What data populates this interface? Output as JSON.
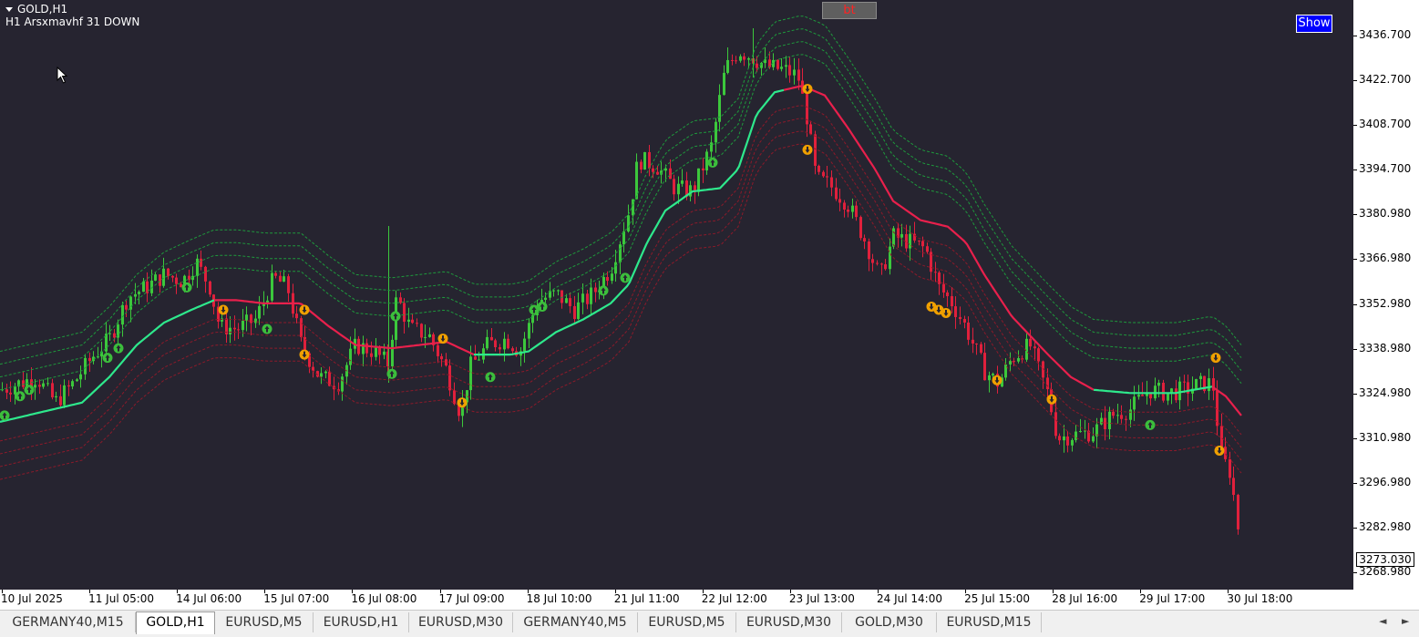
{
  "chart": {
    "symbol_line": "GOLD,H1",
    "indicator_line": "H1 Arsxmavhf 31 DOWN",
    "bt_label": "bt",
    "show_label": "Show",
    "current_price": "3273.030"
  },
  "colors": {
    "background": "#262430",
    "bull_candle": "#3cc83c",
    "bear_candle": "#e0203c",
    "ma_up": "#2ee88c",
    "ma_down": "#e8204c",
    "band_up": "#1e9a3c",
    "band_down": "#8c1a2a",
    "buy_marker": "#3cbe3c",
    "sell_marker": "#f0a000"
  },
  "price_axis": [
    "3436.700",
    "3422.700",
    "3408.700",
    "3394.700",
    "3380.980",
    "3366.980",
    "3352.980",
    "3338.980",
    "3324.980",
    "3310.980",
    "3296.980",
    "3282.980",
    "3268.980"
  ],
  "time_axis": [
    "10 Jul 2025",
    "11 Jul 05:00",
    "14 Jul 06:00",
    "15 Jul 07:00",
    "16 Jul 08:00",
    "17 Jul 09:00",
    "18 Jul 10:00",
    "21 Jul 11:00",
    "22 Jul 12:00",
    "23 Jul 13:00",
    "24 Jul 14:00",
    "25 Jul 15:00",
    "28 Jul 16:00",
    "29 Jul 17:00",
    "30 Jul 18:00"
  ],
  "tabs": [
    {
      "label": "GERMANY40,M15",
      "active": false
    },
    {
      "label": "GOLD,H1",
      "active": true
    },
    {
      "label": "EURUSD,M5",
      "active": false
    },
    {
      "label": "EURUSD,H1",
      "active": false
    },
    {
      "label": "EURUSD,M30",
      "active": false
    },
    {
      "label": "GERMANY40,M5",
      "active": false
    },
    {
      "label": "EURUSD,M5",
      "active": false
    },
    {
      "label": "EURUSD,M30",
      "active": false
    },
    {
      "label": "GOLD,M30",
      "active": false
    },
    {
      "label": "EURUSD,M15",
      "active": false
    }
  ],
  "scroll": {
    "left_icon": "◄",
    "right_icon": "►"
  },
  "chart_data": {
    "type": "candlestick",
    "ma_line": [
      [
        0,
        3316
      ],
      [
        30,
        3318
      ],
      [
        60,
        3320
      ],
      [
        90,
        3322
      ],
      [
        120,
        3330
      ],
      [
        150,
        3340
      ],
      [
        180,
        3347
      ],
      [
        210,
        3351
      ],
      [
        235,
        3354
      ],
      [
        260,
        3354
      ],
      [
        290,
        3353
      ],
      [
        330,
        3353
      ],
      [
        360,
        3346
      ],
      [
        390,
        3340
      ],
      [
        430,
        3339
      ],
      [
        460,
        3340
      ],
      [
        490,
        3341
      ],
      [
        520,
        3337
      ],
      [
        560,
        3337
      ],
      [
        580,
        3338
      ],
      [
        610,
        3344
      ],
      [
        640,
        3348
      ],
      [
        670,
        3353
      ],
      [
        690,
        3359
      ],
      [
        710,
        3372
      ],
      [
        730,
        3382
      ],
      [
        760,
        3388
      ],
      [
        790,
        3389
      ],
      [
        810,
        3395
      ],
      [
        830,
        3412
      ],
      [
        850,
        3419
      ],
      [
        880,
        3421
      ],
      [
        905,
        3418
      ],
      [
        930,
        3408
      ],
      [
        960,
        3395
      ],
      [
        980,
        3385
      ],
      [
        1010,
        3379
      ],
      [
        1040,
        3377
      ],
      [
        1060,
        3372
      ],
      [
        1080,
        3362
      ],
      [
        1110,
        3349
      ],
      [
        1150,
        3337
      ],
      [
        1175,
        3330
      ],
      [
        1200,
        3326
      ],
      [
        1240,
        3325
      ],
      [
        1290,
        3325
      ],
      [
        1330,
        3327
      ],
      [
        1345,
        3324
      ],
      [
        1362,
        3318
      ]
    ],
    "ma_colors": [
      {
        "from": 0,
        "to": 235,
        "trend": "up"
      },
      {
        "from": 235,
        "to": 520,
        "trend": "down"
      },
      {
        "from": 520,
        "to": 860,
        "trend": "up"
      },
      {
        "from": 860,
        "to": 1200,
        "trend": "down"
      },
      {
        "from": 1200,
        "to": 1330,
        "trend": "up"
      },
      {
        "from": 1330,
        "to": 1362,
        "trend": "down"
      }
    ],
    "price_path": [
      [
        0,
        3326
      ],
      [
        20,
        3328
      ],
      [
        40,
        3330
      ],
      [
        60,
        3322
      ],
      [
        80,
        3328
      ],
      [
        100,
        3336
      ],
      [
        120,
        3342
      ],
      [
        140,
        3355
      ],
      [
        160,
        3358
      ],
      [
        180,
        3362
      ],
      [
        200,
        3360
      ],
      [
        215,
        3366
      ],
      [
        230,
        3358
      ],
      [
        240,
        3346
      ],
      [
        260,
        3345
      ],
      [
        280,
        3348
      ],
      [
        300,
        3361
      ],
      [
        315,
        3358
      ],
      [
        330,
        3340
      ],
      [
        350,
        3330
      ],
      [
        370,
        3328
      ],
      [
        390,
        3340
      ],
      [
        410,
        3338
      ],
      [
        425,
        3334
      ],
      [
        435,
        3355
      ],
      [
        450,
        3345
      ],
      [
        470,
        3343
      ],
      [
        490,
        3332
      ],
      [
        505,
        3318
      ],
      [
        515,
        3333
      ],
      [
        535,
        3340
      ],
      [
        555,
        3342
      ],
      [
        570,
        3338
      ],
      [
        590,
        3354
      ],
      [
        610,
        3356
      ],
      [
        630,
        3351
      ],
      [
        650,
        3356
      ],
      [
        670,
        3364
      ],
      [
        690,
        3382
      ],
      [
        700,
        3398
      ],
      [
        720,
        3396
      ],
      [
        740,
        3389
      ],
      [
        760,
        3388
      ],
      [
        780,
        3402
      ],
      [
        795,
        3426
      ],
      [
        810,
        3432
      ],
      [
        825,
        3430
      ],
      [
        840,
        3427
      ],
      [
        860,
        3426
      ],
      [
        875,
        3424
      ],
      [
        885,
        3411
      ],
      [
        895,
        3392
      ],
      [
        910,
        3390
      ],
      [
        930,
        3384
      ],
      [
        950,
        3372
      ],
      [
        965,
        3361
      ],
      [
        980,
        3374
      ],
      [
        1000,
        3372
      ],
      [
        1015,
        3370
      ],
      [
        1030,
        3358
      ],
      [
        1045,
        3353
      ],
      [
        1060,
        3345
      ],
      [
        1080,
        3332
      ],
      [
        1095,
        3328
      ],
      [
        1110,
        3336
      ],
      [
        1130,
        3340
      ],
      [
        1150,
        3324
      ],
      [
        1160,
        3311
      ],
      [
        1180,
        3312
      ],
      [
        1200,
        3313
      ],
      [
        1220,
        3318
      ],
      [
        1240,
        3320
      ],
      [
        1260,
        3326
      ],
      [
        1280,
        3325
      ],
      [
        1300,
        3326
      ],
      [
        1320,
        3328
      ],
      [
        1330,
        3328
      ],
      [
        1340,
        3305
      ],
      [
        1350,
        3300
      ],
      [
        1358,
        3283
      ],
      [
        1362,
        3270
      ]
    ],
    "buy_markers": [
      [
        5,
        3318
      ],
      [
        22,
        3324
      ],
      [
        32,
        3326
      ],
      [
        118,
        3336
      ],
      [
        130,
        3339
      ],
      [
        205,
        3358
      ],
      [
        293,
        3345
      ],
      [
        434,
        3349
      ],
      [
        430,
        3331
      ],
      [
        538,
        3330
      ],
      [
        586,
        3351
      ],
      [
        595,
        3352
      ],
      [
        662,
        3357
      ],
      [
        686,
        3361
      ],
      [
        782,
        3397
      ],
      [
        1262,
        3315
      ]
    ],
    "sell_markers": [
      [
        245,
        3351
      ],
      [
        334,
        3351
      ],
      [
        334,
        3337
      ],
      [
        486,
        3342
      ],
      [
        507,
        3322
      ],
      [
        886,
        3420
      ],
      [
        886,
        3401
      ],
      [
        1022,
        3352
      ],
      [
        1030,
        3351
      ],
      [
        1038,
        3350
      ],
      [
        1094,
        3329
      ],
      [
        1154,
        3323
      ],
      [
        1334,
        3336
      ],
      [
        1338,
        3307
      ]
    ],
    "y_min": 3265,
    "y_max": 3446,
    "x_range": [
      0,
      1365
    ]
  }
}
